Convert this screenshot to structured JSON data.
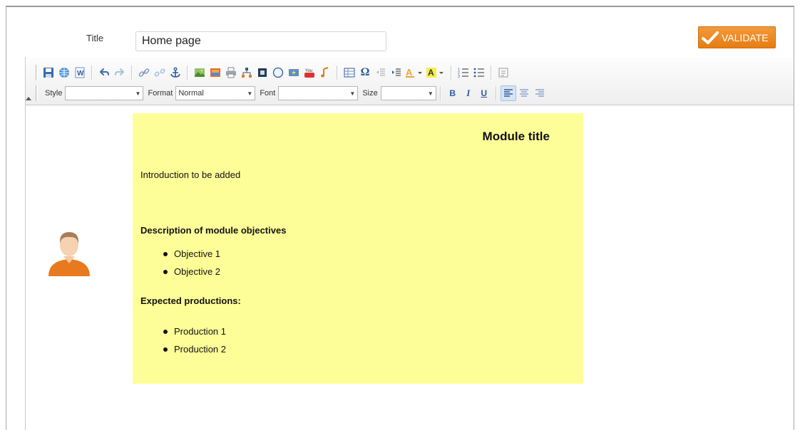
{
  "form": {
    "title_label": "Title",
    "title_value": "Home page",
    "validate_label": "VALIDATE"
  },
  "toolbar": {
    "row1_buttons": [
      {
        "icon": "save-icon"
      },
      {
        "icon": "globe-icon"
      },
      {
        "icon": "word-icon"
      },
      {
        "icon": "undo-icon"
      },
      {
        "icon": "redo-icon"
      },
      {
        "icon": "link-icon"
      },
      {
        "icon": "unlink-icon"
      },
      {
        "icon": "anchor-icon"
      },
      {
        "icon": "image-icon"
      },
      {
        "icon": "gallery-icon"
      },
      {
        "icon": "print-icon"
      },
      {
        "icon": "sitemap-icon"
      },
      {
        "icon": "media-icon"
      },
      {
        "icon": "compass-icon"
      },
      {
        "icon": "flash-icon"
      },
      {
        "icon": "youtube-icon"
      },
      {
        "icon": "music-icon"
      },
      {
        "icon": "table-icon"
      },
      {
        "icon": "special-char-icon"
      },
      {
        "icon": "outdent-icon"
      },
      {
        "icon": "indent-icon"
      },
      {
        "icon": "text-color-icon"
      },
      {
        "icon": "bg-color-icon"
      },
      {
        "icon": "numbered-list-icon"
      },
      {
        "icon": "bulleted-list-icon"
      },
      {
        "icon": "source-icon"
      }
    ],
    "style_label": "Style",
    "style_value": "",
    "format_label": "Format",
    "format_value": "Normal",
    "font_label": "Font",
    "font_value": "",
    "size_label": "Size",
    "size_value": "",
    "bold_label": "B",
    "italic_label": "I",
    "underline_label": "U",
    "youtube_text": "You",
    "text_color_glyph": "A",
    "bg_color_glyph": "A",
    "special_char_glyph": "Ω"
  },
  "content": {
    "module_title": "Module title",
    "introduction": "Introduction to be added",
    "objectives_heading": "Description of module objectives",
    "objectives": [
      "Objective 1",
      "Objective 2"
    ],
    "productions_heading": "Expected productions:",
    "productions": [
      "Production 1",
      "Production 2"
    ]
  },
  "colors": {
    "accent": "#f08a24",
    "card_background": "#fefe99",
    "active_button": "#d6e4f4"
  }
}
